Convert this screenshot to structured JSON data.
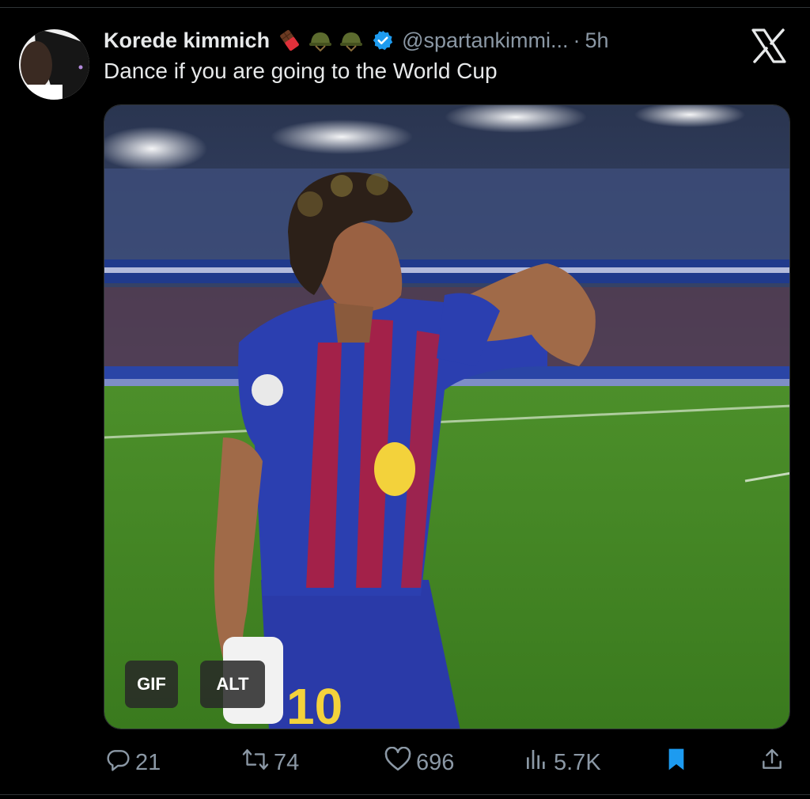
{
  "tweet": {
    "author_name": "Korede kimmich",
    "handle": "@spartankimmi...",
    "separator": "·",
    "time": "5h",
    "text": "Dance if you are going to the World Cup",
    "emojis": [
      "chocolate-bar-emoji",
      "military-helmet-emoji",
      "military-helmet-emoji"
    ],
    "verified": true
  },
  "media": {
    "gif_badge": "GIF",
    "alt_badge": "ALT",
    "jersey_number": "10"
  },
  "actions": {
    "replies": "21",
    "reposts": "74",
    "likes": "696",
    "views": "5.7K"
  },
  "colors": {
    "background": "#000000",
    "text": "#e7e9ea",
    "muted": "#8b98a5",
    "accent": "#1d9bf0"
  }
}
